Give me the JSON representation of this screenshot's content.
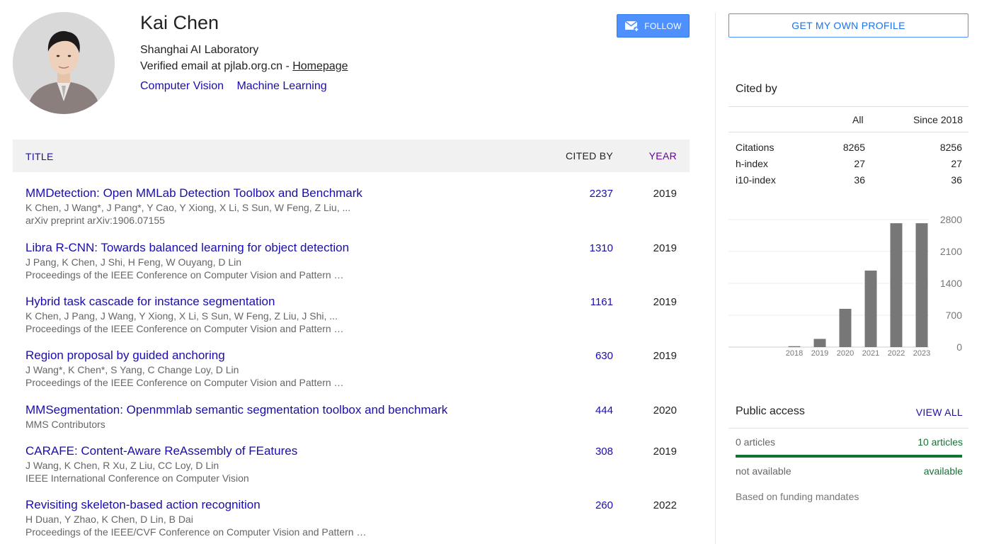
{
  "profile": {
    "name": "Kai Chen",
    "affiliation": "Shanghai AI Laboratory",
    "email_prefix": "Verified email at pjlab.org.cn - ",
    "homepage_label": "Homepage",
    "interests": [
      "Computer Vision",
      "Machine Learning"
    ],
    "follow_label": "FOLLOW"
  },
  "table": {
    "header": {
      "title": "TITLE",
      "cited_by": "CITED BY",
      "year": "YEAR"
    },
    "rows": [
      {
        "title": "MMDetection: Open MMLab Detection Toolbox and Benchmark",
        "authors": "K Chen, J Wang*, J Pang*, Y Cao, Y Xiong, X Li, S Sun, W Feng, Z Liu, ...",
        "venue": "arXiv preprint arXiv:1906.07155",
        "cited_by": "2237",
        "year": "2019"
      },
      {
        "title": "Libra R-CNN: Towards balanced learning for object detection",
        "authors": "J Pang, K Chen, J Shi, H Feng, W Ouyang, D Lin",
        "venue": "Proceedings of the IEEE Conference on Computer Vision and Pattern …",
        "cited_by": "1310",
        "year": "2019"
      },
      {
        "title": "Hybrid task cascade for instance segmentation",
        "authors": "K Chen, J Pang, J Wang, Y Xiong, X Li, S Sun, W Feng, Z Liu, J Shi, ...",
        "venue": "Proceedings of the IEEE Conference on Computer Vision and Pattern …",
        "cited_by": "1161",
        "year": "2019"
      },
      {
        "title": "Region proposal by guided anchoring",
        "authors": "J Wang*, K Chen*, S Yang, C Change Loy, D Lin",
        "venue": "Proceedings of the IEEE Conference on Computer Vision and Pattern …",
        "cited_by": "630",
        "year": "2019"
      },
      {
        "title": "MMSegmentation: Openmmlab semantic segmentation toolbox and benchmark",
        "authors": "MMS Contributors",
        "venue": "",
        "cited_by": "444",
        "year": "2020"
      },
      {
        "title": "CARAFE: Content-Aware ReAssembly of FEatures",
        "authors": "J Wang, K Chen, R Xu, Z Liu, CC Loy, D Lin",
        "venue": "IEEE International Conference on Computer Vision",
        "cited_by": "308",
        "year": "2019"
      },
      {
        "title": "Revisiting skeleton-based action recognition",
        "authors": "H Duan, Y Zhao, K Chen, D Lin, B Dai",
        "venue": "Proceedings of the IEEE/CVF Conference on Computer Vision and Pattern …",
        "cited_by": "260",
        "year": "2022"
      }
    ]
  },
  "sidebar": {
    "own_profile_label": "GET MY OWN PROFILE",
    "cited_by": {
      "heading": "Cited by",
      "col_all": "All",
      "col_since": "Since 2018",
      "stats": [
        {
          "label": "Citations",
          "all": "8265",
          "since": "8256"
        },
        {
          "label": "h-index",
          "all": "27",
          "since": "27"
        },
        {
          "label": "i10-index",
          "all": "36",
          "since": "36"
        }
      ]
    },
    "public_access": {
      "heading": "Public access",
      "view_all": "VIEW ALL",
      "not_available_count": "0 articles",
      "available_count": "10 articles",
      "not_available_label": "not available",
      "available_label": "available",
      "available_fraction": 1.0,
      "note": "Based on funding mandates"
    }
  },
  "colors": {
    "link": "#1a0dab",
    "follow_bg": "#4d90fe",
    "bar": "#777777",
    "available": "#137333"
  },
  "chart_data": {
    "type": "bar",
    "categories": [
      "2018",
      "2019",
      "2020",
      "2021",
      "2022",
      "2023"
    ],
    "values": [
      20,
      180,
      840,
      1680,
      2720,
      2720
    ],
    "yticks": [
      0,
      700,
      1400,
      2100,
      2800
    ],
    "ylim": [
      0,
      2800
    ],
    "grid": true
  }
}
